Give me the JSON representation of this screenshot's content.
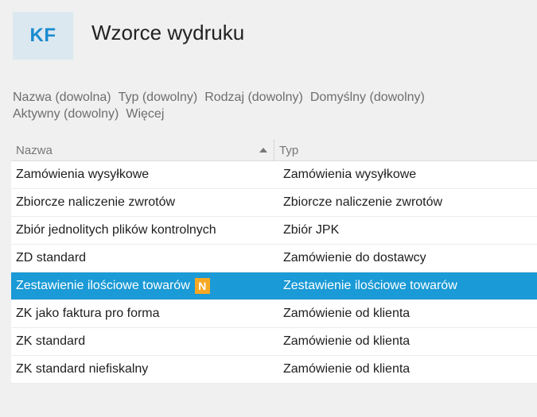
{
  "app": {
    "logo": "KF",
    "title": "Wzorce wydruku"
  },
  "filters": [
    "Nazwa (dowolna)",
    "Typ (dowolny)",
    "Rodzaj (dowolny)",
    "Domyślny (dowolny)",
    "Aktywny (dowolny)",
    "Więcej"
  ],
  "table": {
    "columns": {
      "name": "Nazwa",
      "type": "Typ"
    },
    "sort_icon": "sort-ascending-icon",
    "rows": [
      {
        "name": "Zamówienia wysyłkowe",
        "type": "Zamówienia wysyłkowe"
      },
      {
        "name": "Zbiorcze naliczenie zwrotów",
        "type": "Zbiorcze naliczenie zwrotów"
      },
      {
        "name": "Zbiór jednolitych plików kontrolnych",
        "type": "Zbiór JPK"
      },
      {
        "name": "ZD standard",
        "type": "Zamówienie do dostawcy"
      },
      {
        "name": "Zestawienie ilościowe towarów",
        "type": "Zestawienie ilościowe towarów",
        "badge": "N"
      },
      {
        "name": "ZK jako faktura pro forma",
        "type": "Zamówienie od klienta"
      },
      {
        "name": "ZK standard",
        "type": "Zamówienie od klienta"
      },
      {
        "name": "ZK standard niefiskalny",
        "type": "Zamówienie od klienta"
      }
    ]
  },
  "colors": {
    "accent": "#1a9ad6",
    "badge": "#f7a823",
    "logo_text": "#1a8bd0",
    "logo_bg": "#dbe8f0"
  }
}
